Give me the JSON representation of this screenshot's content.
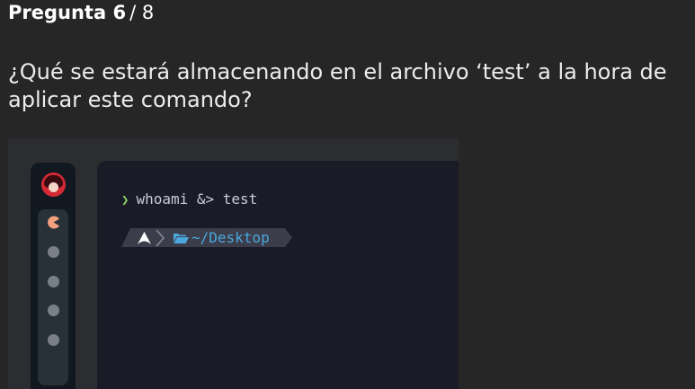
{
  "question": {
    "label": "Pregunta 6",
    "separator": "/",
    "total": "8",
    "text": "¿Qué se estará almacenando en el archivo ‘test’ a la hora de aplicar este comando?"
  },
  "terminal": {
    "command": "whoami &> test",
    "prompt_path": "~/Desktop"
  },
  "icons": {
    "logo": "avatar-logo-icon",
    "active_workspace": "pacman-icon",
    "prompt_os": "arch-linux-icon",
    "prompt_separator": "chevron-right-icon",
    "prompt_folder": "folder-open-icon",
    "cmd_prompt": "chevron-right-icon"
  },
  "colors": {
    "page_bg": "#262626",
    "terminal_bg": "#1a1b26",
    "sidebar_bg": "#121820",
    "prompt_green": "#8bd06a",
    "path_blue": "#4aa8dc",
    "logo_red": "#d42a35",
    "active_workspace": "#f3a07f"
  }
}
